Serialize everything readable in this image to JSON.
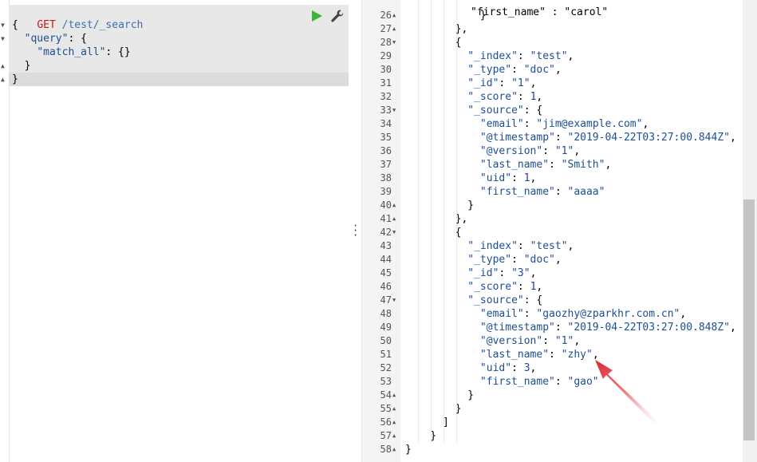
{
  "request": {
    "method": "GET",
    "path": "/test/_search",
    "lines": [
      "{",
      "  \"query\": {",
      "    \"match_all\": {}",
      "  }",
      "}"
    ]
  },
  "toolbar": {
    "run_icon": "play-icon",
    "settings_icon": "wrench-icon"
  },
  "response": {
    "partial_top_line": "\"first_name\" : \"carol\"",
    "lines": [
      {
        "n": "26",
        "fold": "▲",
        "text": "            }"
      },
      {
        "n": "27",
        "fold": "▲",
        "text": "        },"
      },
      {
        "n": "28",
        "fold": "▼",
        "text": "        {"
      },
      {
        "n": "29",
        "fold": "",
        "text": "          \"_index\": \"test\","
      },
      {
        "n": "30",
        "fold": "",
        "text": "          \"_type\": \"doc\","
      },
      {
        "n": "31",
        "fold": "",
        "text": "          \"_id\": \"1\","
      },
      {
        "n": "32",
        "fold": "",
        "text": "          \"_score\": 1,"
      },
      {
        "n": "33",
        "fold": "▼",
        "text": "          \"_source\": {"
      },
      {
        "n": "34",
        "fold": "",
        "text": "            \"email\": \"jim@example.com\","
      },
      {
        "n": "35",
        "fold": "",
        "text": "            \"@timestamp\": \"2019-04-22T03:27:00.844Z\","
      },
      {
        "n": "36",
        "fold": "",
        "text": "            \"@version\": \"1\","
      },
      {
        "n": "37",
        "fold": "",
        "text": "            \"last_name\": \"Smith\","
      },
      {
        "n": "38",
        "fold": "",
        "text": "            \"uid\": 1,"
      },
      {
        "n": "39",
        "fold": "",
        "text": "            \"first_name\": \"aaaa\""
      },
      {
        "n": "40",
        "fold": "▲",
        "text": "          }"
      },
      {
        "n": "41",
        "fold": "▲",
        "text": "        },"
      },
      {
        "n": "42",
        "fold": "▼",
        "text": "        {"
      },
      {
        "n": "43",
        "fold": "",
        "text": "          \"_index\": \"test\","
      },
      {
        "n": "44",
        "fold": "",
        "text": "          \"_type\": \"doc\","
      },
      {
        "n": "45",
        "fold": "",
        "text": "          \"_id\": \"3\","
      },
      {
        "n": "46",
        "fold": "",
        "text": "          \"_score\": 1,"
      },
      {
        "n": "47",
        "fold": "▼",
        "text": "          \"_source\": {"
      },
      {
        "n": "48",
        "fold": "",
        "text": "            \"email\": \"gaozhy@zparkhr.com.cn\","
      },
      {
        "n": "49",
        "fold": "",
        "text": "            \"@timestamp\": \"2019-04-22T03:27:00.848Z\","
      },
      {
        "n": "50",
        "fold": "",
        "text": "            \"@version\": \"1\","
      },
      {
        "n": "51",
        "fold": "",
        "text": "            \"last_name\": \"zhy\","
      },
      {
        "n": "52",
        "fold": "",
        "text": "            \"uid\": 3,"
      },
      {
        "n": "53",
        "fold": "",
        "text": "            \"first_name\": \"gao\""
      },
      {
        "n": "54",
        "fold": "▲",
        "text": "          }"
      },
      {
        "n": "55",
        "fold": "▲",
        "text": "        }"
      },
      {
        "n": "56",
        "fold": "▲",
        "text": "      ]"
      },
      {
        "n": "57",
        "fold": "▲",
        "text": "    }"
      },
      {
        "n": "58",
        "fold": "▲",
        "text": "}"
      }
    ]
  },
  "colors": {
    "method": "#c41a16",
    "path": "#3d6fb3",
    "key": "#1d4f91",
    "run": "#3cb53c",
    "arrow": "#d9262e"
  }
}
